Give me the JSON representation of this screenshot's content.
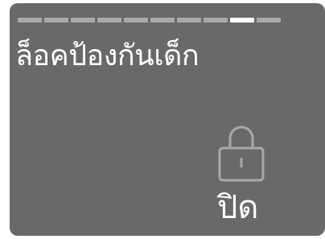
{
  "setting": {
    "title": "ล็อคป้องกันเด็ก",
    "state": "ปิด",
    "icon": "lock-icon"
  },
  "pagination": {
    "total_pages": 10,
    "current_page": 9
  },
  "colors": {
    "panel_background": "#696969",
    "text": "#ffffff",
    "indicator_inactive": "#a9a9a9",
    "indicator_active": "#ffffff",
    "icon_stroke": "#a9a9a9"
  }
}
